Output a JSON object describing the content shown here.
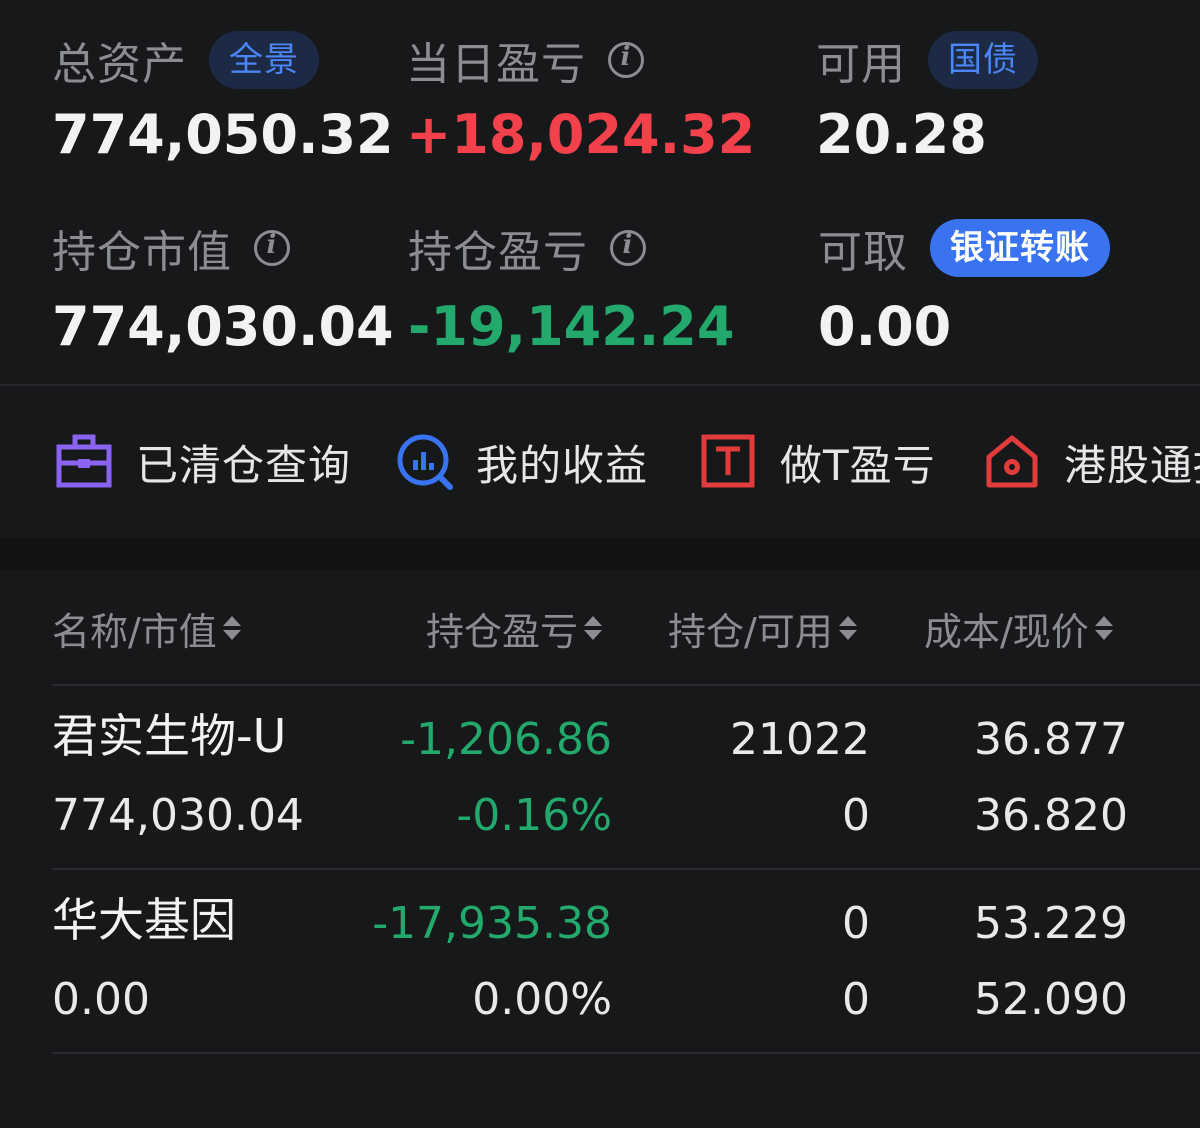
{
  "summary": {
    "total_assets": {
      "label": "总资产",
      "badge": "全景",
      "value": "774,050.32"
    },
    "day_pnl": {
      "label": "当日盈亏",
      "value": "+18,024.32"
    },
    "available": {
      "label": "可用",
      "badge": "国债",
      "value": "20.28"
    },
    "market_value": {
      "label": "持仓市值",
      "value": "774,030.04"
    },
    "position_pnl": {
      "label": "持仓盈亏",
      "value": "-19,142.24"
    },
    "withdrawable": {
      "label": "可取",
      "badge": "银证转账",
      "value": "0.00"
    }
  },
  "shortcuts": [
    {
      "label": "已清仓查询",
      "icon": "briefcase-icon"
    },
    {
      "label": "我的收益",
      "icon": "chart-search-icon"
    },
    {
      "label": "做T盈亏",
      "icon": "t-box-icon"
    },
    {
      "label": "港股通持",
      "icon": "hk-house-icon"
    }
  ],
  "table": {
    "headers": [
      "名称/市值",
      "持仓盈亏",
      "持仓/可用",
      "成本/现价"
    ],
    "rows": [
      {
        "name": "君实生物-U",
        "market_value": "774,030.04",
        "pnl": "-1,206.86",
        "pnl_pct": "-0.16%",
        "position": "21022",
        "available": "0",
        "cost": "36.877",
        "price": "36.820"
      },
      {
        "name": "华大基因",
        "market_value": "0.00",
        "pnl": "-17,935.38",
        "pnl_pct": "0.00%",
        "position": "0",
        "available": "0",
        "cost": "53.229",
        "price": "52.090"
      }
    ]
  },
  "colors": {
    "up": "#f2414a",
    "down": "#23a96b",
    "accent": "#3a73f0"
  }
}
